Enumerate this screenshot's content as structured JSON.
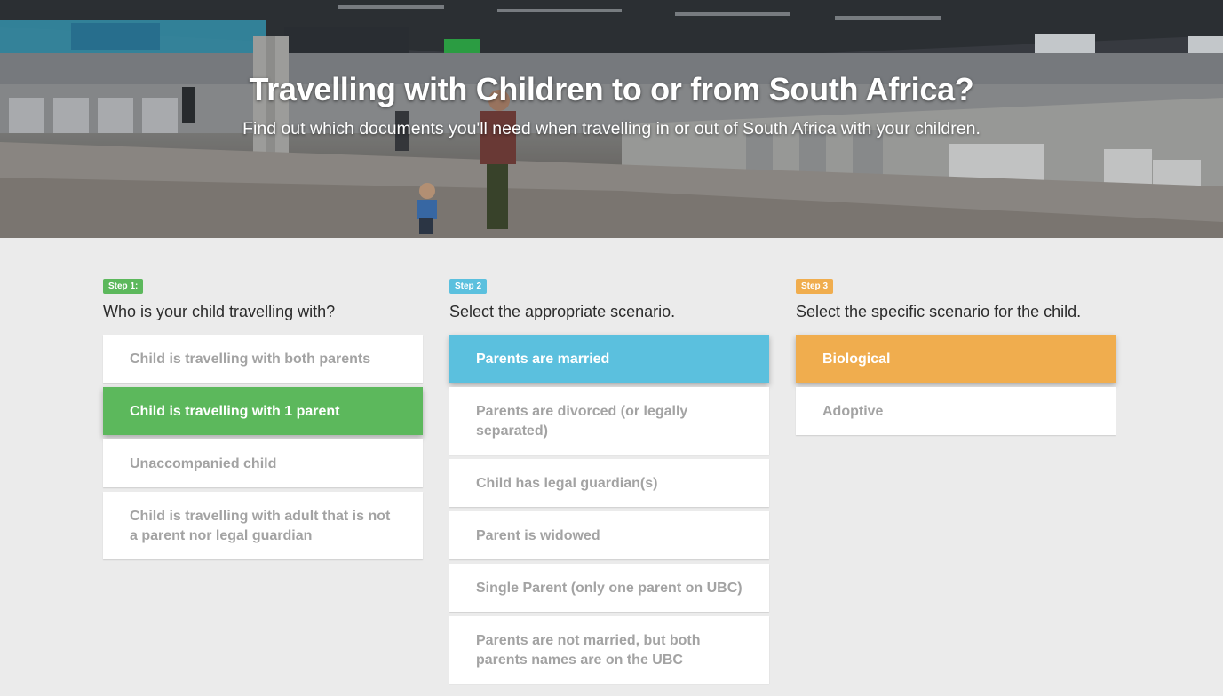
{
  "hero": {
    "title": "Travelling with Children to or from South Africa?",
    "subtitle": "Find out which documents you'll need when travelling in or out of South Africa with your children."
  },
  "steps": [
    {
      "badge": "Step 1:",
      "color": "#5cb85c",
      "question": "Who is your child travelling with?",
      "options": [
        {
          "label": "Child is travelling with both parents",
          "selected": false
        },
        {
          "label": "Child is travelling with 1 parent",
          "selected": true
        },
        {
          "label": "Unaccompanied child",
          "selected": false
        },
        {
          "label": "Child is travelling with adult that is not a parent nor legal guardian",
          "selected": false
        }
      ]
    },
    {
      "badge": "Step 2",
      "color": "#5bc0de",
      "question": "Select the appropriate scenario.",
      "options": [
        {
          "label": "Parents are married",
          "selected": true
        },
        {
          "label": "Parents are divorced (or legally separated)",
          "selected": false
        },
        {
          "label": "Child has legal guardian(s)",
          "selected": false
        },
        {
          "label": "Parent is widowed",
          "selected": false
        },
        {
          "label": "Single Parent (only one parent on UBC)",
          "selected": false
        },
        {
          "label": "Parents are not married, but both parents names are on the UBC",
          "selected": false
        }
      ]
    },
    {
      "badge": "Step 3",
      "color": "#f0ad4e",
      "question": "Select the specific scenario for the child.",
      "options": [
        {
          "label": "Biological",
          "selected": true
        },
        {
          "label": "Adoptive",
          "selected": false
        }
      ]
    }
  ]
}
